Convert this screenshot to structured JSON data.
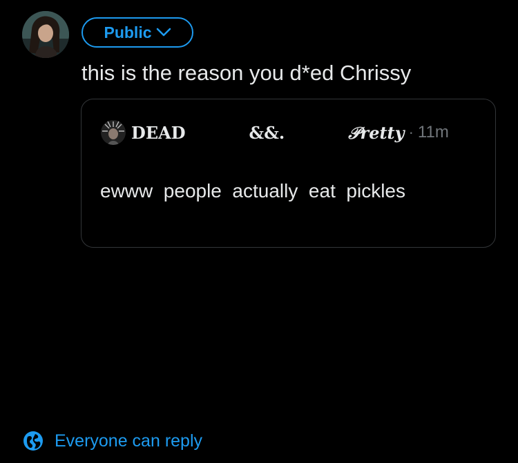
{
  "composer": {
    "avatar_icon": "user-avatar-photo",
    "audience": {
      "label": "Public",
      "icon": "chevron-down-icon",
      "color": "#1d9bf0"
    },
    "text": "this is the reason you d*ed Chrissy"
  },
  "quote": {
    "avatar_icon": "quoted-user-avatar-photo",
    "display_name": {
      "part1": "DEAD",
      "part2": "&&.",
      "part3": "𝒫retty"
    },
    "separator": "·",
    "time": "11m",
    "body": "ewww  people  actually  eat  pickles"
  },
  "reply_setting": {
    "icon": "globe-icon",
    "label": "Everyone can reply",
    "color": "#1d9bf0"
  },
  "colors": {
    "background": "#000000",
    "text": "#e7e9ea",
    "secondary_text": "#71767b",
    "accent": "#1d9bf0",
    "card_border": "#333639"
  }
}
